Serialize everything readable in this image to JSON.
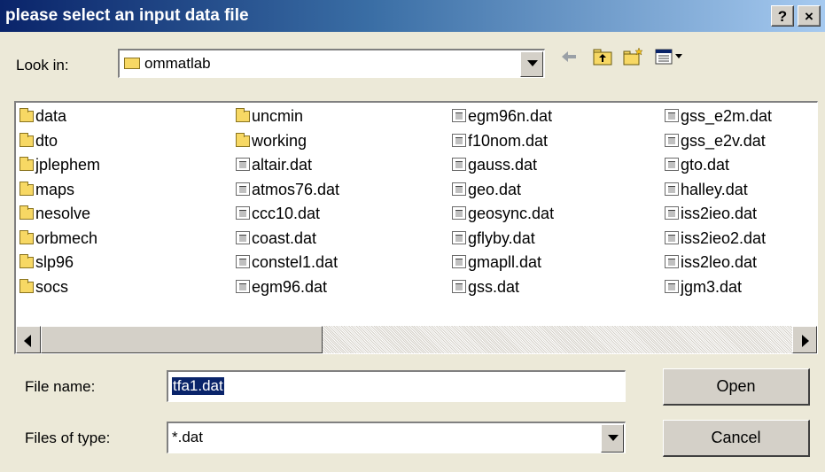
{
  "window": {
    "title": "please select an input data file",
    "help_label": "?",
    "close_label": "×"
  },
  "look_in": {
    "label": "Look in:",
    "value": "ommatlab"
  },
  "toolbar": {
    "icons": [
      "back-arrow-icon",
      "up-one-level-icon",
      "new-folder-icon",
      "view-menu-icon"
    ]
  },
  "files": {
    "col1": [
      "data",
      "dto",
      "jplephem",
      "maps",
      "nesolve",
      "orbmech",
      "slp96",
      "socs"
    ],
    "col2": [
      "uncmin",
      "working",
      "altair.dat",
      "atmos76.dat",
      "ccc10.dat",
      "coast.dat",
      "constel1.dat",
      "egm96.dat"
    ],
    "col3": [
      "egm96n.dat",
      "f10nom.dat",
      "gauss.dat",
      "geo.dat",
      "geosync.dat",
      "gflyby.dat",
      "gmapll.dat",
      "gss.dat"
    ],
    "col4": [
      "gss_e2m.dat",
      "gss_e2v.dat",
      "gto.dat",
      "halley.dat",
      "iss2ieo.dat",
      "iss2ieo2.dat",
      "iss2leo.dat",
      "jgm3.dat"
    ]
  },
  "file_name": {
    "label": "File name:",
    "value": "tfa1.dat"
  },
  "file_type": {
    "label": "Files of type:",
    "value": "*.dat"
  },
  "buttons": {
    "open": "Open",
    "cancel": "Cancel"
  },
  "colors": {
    "title_start": "#0a246a",
    "title_end": "#a6caf0",
    "dialog_bg": "#ece9d8",
    "selection": "#0a246a"
  }
}
